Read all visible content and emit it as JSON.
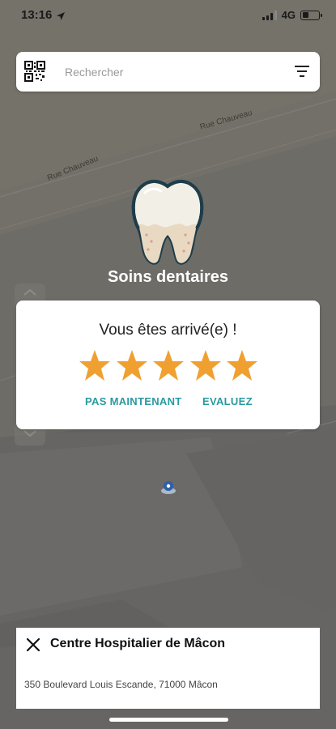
{
  "status_bar": {
    "time": "13:16",
    "network": "4G",
    "battery_level": 0.4
  },
  "map": {
    "streets": [
      "Rue Chauveau",
      "Rue Chauveau"
    ]
  },
  "search": {
    "placeholder": "Rechercher",
    "value": ""
  },
  "category": {
    "title": "Soins dentaires",
    "icon": "tooth-icon"
  },
  "rating_dialog": {
    "title": "Vous êtes arrivé(e) !",
    "stars_count": 5,
    "star_color": "#f0a030",
    "later_label": "PAS MAINTENANT",
    "rate_label": "EVALUEZ",
    "action_color": "#2a9aa1"
  },
  "place": {
    "name": "Centre Hospitalier de Mâcon",
    "address": "350 Boulevard Louis Escande, 71000 Mâcon"
  }
}
